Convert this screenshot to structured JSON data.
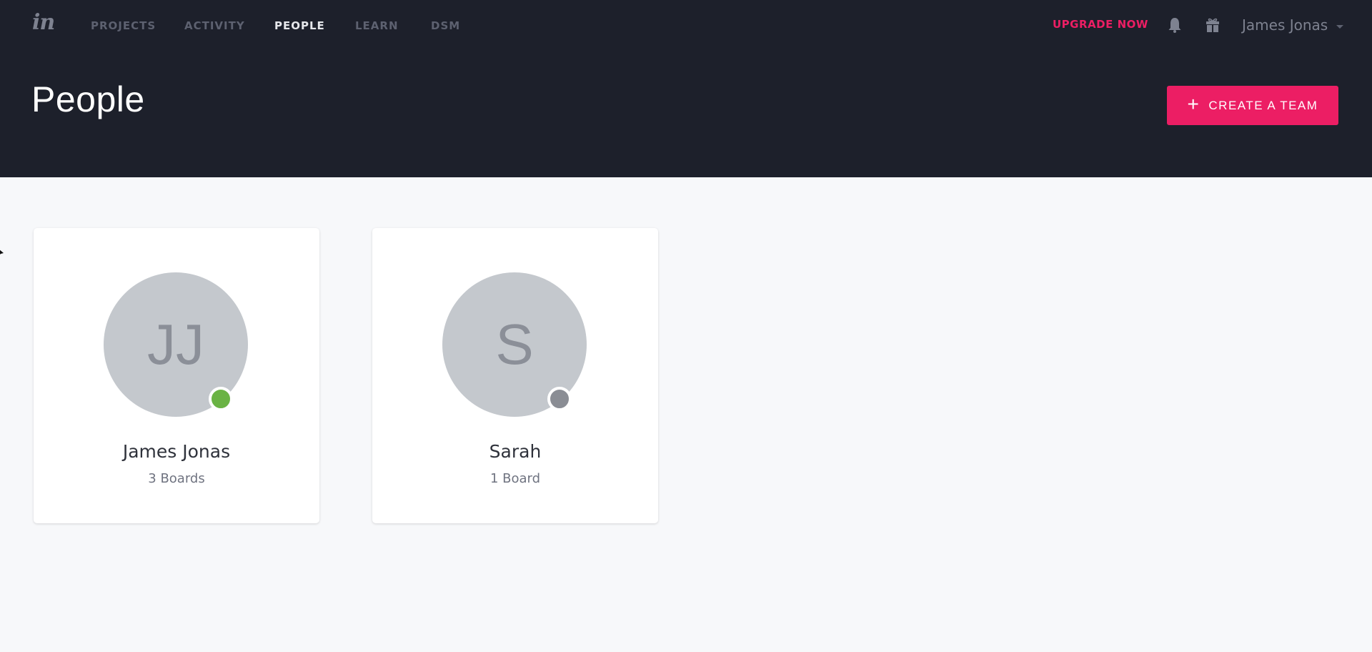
{
  "nav": {
    "logo": "in",
    "items": [
      {
        "label": "PROJECTS",
        "active": false
      },
      {
        "label": "ACTIVITY",
        "active": false
      },
      {
        "label": "PEOPLE",
        "active": true
      },
      {
        "label": "LEARN",
        "active": false
      },
      {
        "label": "DSM",
        "active": false
      }
    ],
    "upgrade_label": "UPGRADE NOW",
    "notifications_icon": "bell-icon",
    "gift_icon": "gift-icon",
    "user_name": "James Jonas"
  },
  "header": {
    "title": "People",
    "create_button_label": "CREATE A TEAM",
    "create_button_icon": "plus-icon"
  },
  "people": [
    {
      "initials": "JJ",
      "name": "James Jonas",
      "boards": "3 Boards",
      "status": "online",
      "status_color": "#6ab344"
    },
    {
      "initials": "S",
      "name": "Sarah",
      "boards": "1 Board",
      "status": "offline",
      "status_color": "#8a8d94"
    }
  ],
  "colors": {
    "accent": "#ec1e64",
    "header_bg": "#1d202b",
    "page_bg": "#f7f8fa",
    "avatar_bg": "#c4c8cd"
  }
}
